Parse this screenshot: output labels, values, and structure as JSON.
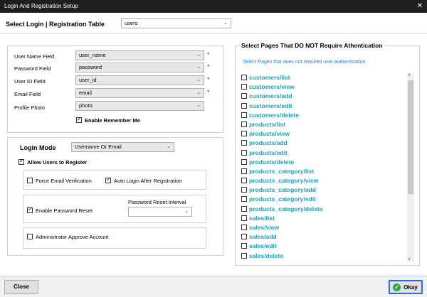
{
  "window": {
    "title": "Login And Registration Setup",
    "close_glyph": "✕"
  },
  "header": {
    "label": "Select Login | Registration Table",
    "table_value": "users"
  },
  "fields": {
    "user_name": {
      "label": "User Name Field",
      "value": "user_name"
    },
    "password": {
      "label": "Password Field",
      "value": "password"
    },
    "user_id": {
      "label": "User ID Field",
      "value": "user_id"
    },
    "email": {
      "label": "Email Field",
      "value": "email"
    },
    "profile_photo": {
      "label": "Profile Photo",
      "value": "photo"
    },
    "required_mark": "*"
  },
  "remember_me": {
    "label": "Enable Remember Me",
    "checked": true
  },
  "login_mode": {
    "label": "Login Mode",
    "value": "Username Or Email"
  },
  "registration": {
    "allow_label": "Allow Users to Register",
    "force_email": "Force Email Verification",
    "auto_login": "Auto Login After Registration",
    "password_reset": "Enable Password Reset",
    "reset_interval_label": "Password Reset Interval",
    "reset_interval_value": "",
    "admin_approve": "Administrator Approve Account"
  },
  "pages_panel": {
    "title": "Select Pages That DO NOT Require Athentication",
    "subtitle": "Select Pages that does not required user authentication",
    "pages": [
      "customers/list",
      "customers/view",
      "customers/add",
      "customers/edit",
      "customers/delete",
      "products/list",
      "products/view",
      "products/add",
      "products/edit",
      "products/delete",
      "products_category/list",
      "products_category/view",
      "products_category/add",
      "products_category/edit",
      "products_category/delete",
      "sales/list",
      "sales/view",
      "sales/add",
      "sales/edit",
      "sales/delete"
    ]
  },
  "footer": {
    "close_label": "Close",
    "okay_label": "Okay"
  },
  "icons": {
    "chevron": "chevron-down-icon",
    "check": "check-icon"
  }
}
